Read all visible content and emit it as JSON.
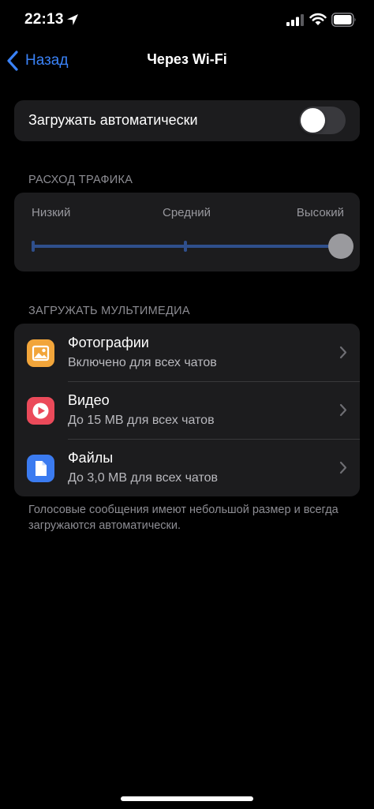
{
  "status_bar": {
    "time": "22:13",
    "icons": [
      "location-arrow-icon",
      "cellular-signal-icon",
      "wifi-icon",
      "battery-icon"
    ]
  },
  "nav": {
    "back_label": "Назад",
    "title": "Через Wi-Fi",
    "accent_color": "#3a82f7"
  },
  "auto_download": {
    "label": "Загружать автоматически",
    "enabled": false
  },
  "traffic": {
    "header": "РАСХОД ТРАФИКА",
    "levels": [
      "Низкий",
      "Средний",
      "Высокий"
    ],
    "selected": "Высокий"
  },
  "media": {
    "header": "ЗАГРУЖАТЬ МУЛЬТИМЕДИА",
    "items": [
      {
        "title": "Фотографии",
        "subtitle": "Включено для всех чатов",
        "icon": "photo-icon",
        "color": "#f2a53a"
      },
      {
        "title": "Видео",
        "subtitle": "До 15 MB для всех чатов",
        "icon": "video-icon",
        "color": "#eb4a5a"
      },
      {
        "title": "Файлы",
        "subtitle": "До 3,0 MB для всех чатов",
        "icon": "file-icon",
        "color": "#3b7bf0"
      }
    ]
  },
  "footer_note": "Голосовые сообщения имеют небольшой размер и всегда загружаются автоматически."
}
